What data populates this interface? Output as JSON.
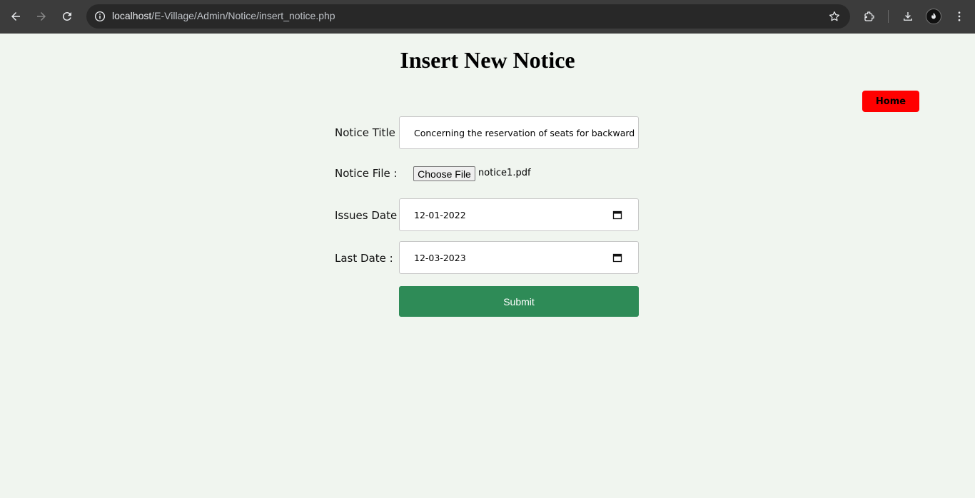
{
  "browser": {
    "url_host": "localhost",
    "url_path": "/E-Village/Admin/Notice/insert_notice.php"
  },
  "page": {
    "title": "Insert New Notice",
    "home_label": "Home"
  },
  "form": {
    "notice_title": {
      "label": "Notice Title :",
      "value": "Concerning the reservation of seats for backward"
    },
    "notice_file": {
      "label": "Notice File :",
      "button_label": "Choose File",
      "file_name": "notice1.pdf"
    },
    "issues_date": {
      "label": "Issues Date :",
      "value": "12-01-2022"
    },
    "last_date": {
      "label": "Last Date :",
      "value": "12-03-2023"
    },
    "submit_label": "Submit"
  },
  "colors": {
    "background": "#f0f5ef",
    "home_button": "#ff0000",
    "submit_button": "#2e8b57"
  }
}
